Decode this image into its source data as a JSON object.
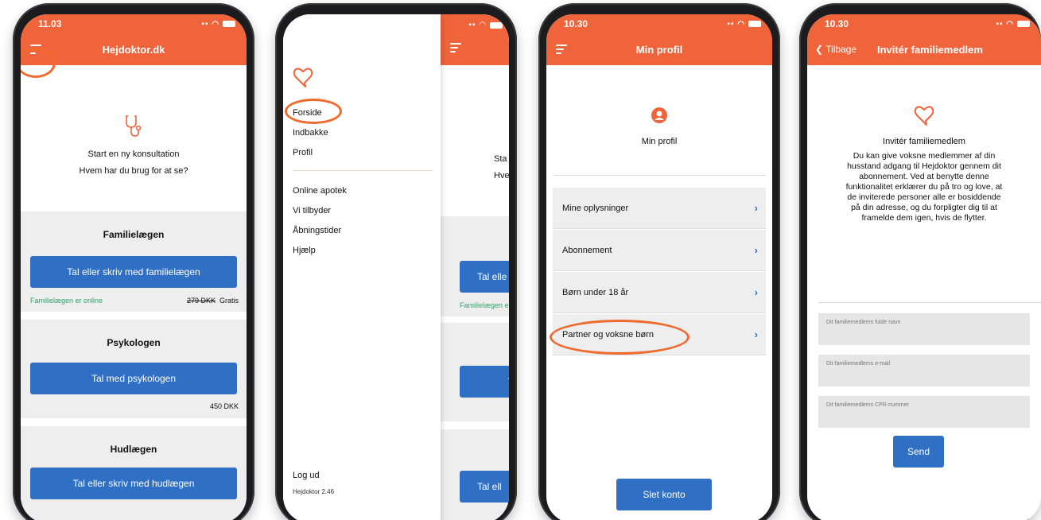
{
  "phones": {
    "p1": {
      "time": "11.03",
      "title": "Hejdoktor.dk",
      "prompt1": "Start en ny konsultation",
      "prompt2": "Hvem har du brug for at se?",
      "cards": [
        {
          "title": "Familielægen",
          "button": "Tal eller skriv med familielægen",
          "status": "Familielægen er online",
          "old_price": "279 DKK",
          "price": "Gratis"
        },
        {
          "title": "Psykologen",
          "button": "Tal med psykologen",
          "price": "450 DKK"
        },
        {
          "title": "Hudlægen",
          "button": "Tal eller skriv med hudlægen"
        }
      ]
    },
    "p2": {
      "menu1": [
        "Forside",
        "Indbakke",
        "Profil"
      ],
      "menu2": [
        "Online apotek",
        "Vi tilbyder",
        "Åbningstider",
        "Hjælp"
      ],
      "logout": "Log ud",
      "version": "Hejdoktor 2.46",
      "peek": {
        "text1": "Sta",
        "text2": "Hvem",
        "btn1": "Tal elle",
        "status": "Familielægen er",
        "btn2": "T",
        "btn3": "Tal ell"
      }
    },
    "p3": {
      "time": "10.30",
      "title": "Min profil",
      "profile_label": "Min profil",
      "rows": [
        "Mine oplysninger",
        "Abonnement",
        "Børn under 18 år",
        "Partner og voksne børn"
      ],
      "delete": "Slet konto"
    },
    "p4": {
      "time": "10.30",
      "back": "Tilbage",
      "title": "Invitér familiemedlem",
      "heading": "Invitér familiemedlem",
      "body": "Du kan give voksne medlemmer af din husstand adgang til Hejdoktor gennem dit abonnement. Ved at benytte denne funktionalitet erklærer du på tro og love, at de inviterede personer alle er bosiddende på din adresse, og du forpligter dig til at framelde dem igen, hvis de flytter.",
      "fields": [
        "Dit familiemedlems fulde navn",
        "Dit familiemedlems e-mail",
        "Dit familiemedlems CPR-nummer"
      ],
      "send": "Send"
    }
  },
  "colors": {
    "brand": "#f0643c",
    "button": "#2f6fc4",
    "highlight": "#ef6a2d"
  }
}
